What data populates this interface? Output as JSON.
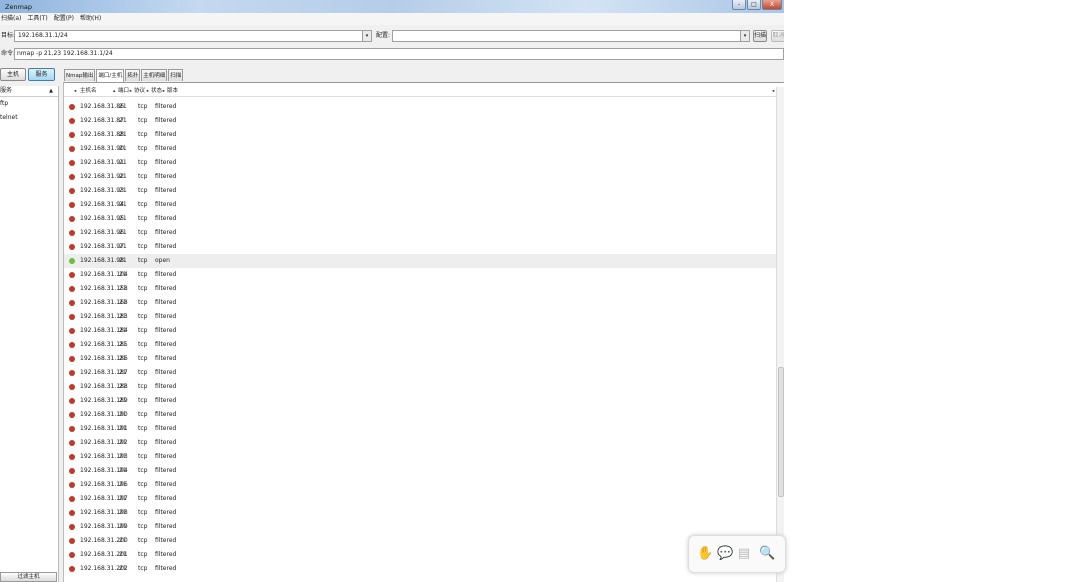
{
  "window": {
    "title": "Zenmap",
    "controls": [
      "-",
      "□",
      "X"
    ]
  },
  "menu": [
    "扫描(a)",
    "工具(T)",
    "配置(P)",
    "帮助(H)"
  ],
  "toolbar": {
    "target_label": "目标:",
    "target_value": "192.168.31.1/24",
    "profile_label": "配置:",
    "profile_value": "",
    "scan_button": "扫描",
    "cancel_button": "取消",
    "command_label": "命令:",
    "command_value": "nmap -p 21,23 192.168.31.1/24"
  },
  "sidebar": {
    "hosts_button": "主机",
    "services_button": "服务",
    "header": "服务",
    "items": [
      "ftp",
      "telnet"
    ],
    "filter_button": "过滤主机"
  },
  "tabs": [
    "Nmap输出",
    "端口/主机",
    "拓扑",
    "主机明细",
    "扫描"
  ],
  "columns": {
    "host": "主机名",
    "port": "端口",
    "protocol": "协议",
    "state": "状态",
    "version": "版本"
  },
  "rows": [
    {
      "host": "192.168.31.86",
      "port": "21",
      "protocol": "tcp",
      "state": "filtered"
    },
    {
      "host": "192.168.31.87",
      "port": "21",
      "protocol": "tcp",
      "state": "filtered"
    },
    {
      "host": "192.168.31.88",
      "port": "21",
      "protocol": "tcp",
      "state": "filtered"
    },
    {
      "host": "192.168.31.90",
      "port": "21",
      "protocol": "tcp",
      "state": "filtered"
    },
    {
      "host": "192.168.31.91",
      "port": "21",
      "protocol": "tcp",
      "state": "filtered"
    },
    {
      "host": "192.168.31.92",
      "port": "21",
      "protocol": "tcp",
      "state": "filtered"
    },
    {
      "host": "192.168.31.93",
      "port": "21",
      "protocol": "tcp",
      "state": "filtered"
    },
    {
      "host": "192.168.31.94",
      "port": "21",
      "protocol": "tcp",
      "state": "filtered"
    },
    {
      "host": "192.168.31.95",
      "port": "21",
      "protocol": "tcp",
      "state": "filtered"
    },
    {
      "host": "192.168.31.96",
      "port": "21",
      "protocol": "tcp",
      "state": "filtered"
    },
    {
      "host": "192.168.31.97",
      "port": "21",
      "protocol": "tcp",
      "state": "filtered"
    },
    {
      "host": "192.168.31.98",
      "port": "21",
      "protocol": "tcp",
      "state": "open"
    },
    {
      "host": "192.168.31.104",
      "port": "21",
      "protocol": "tcp",
      "state": "filtered"
    },
    {
      "host": "192.168.31.158",
      "port": "21",
      "protocol": "tcp",
      "state": "filtered"
    },
    {
      "host": "192.168.31.168",
      "port": "21",
      "protocol": "tcp",
      "state": "filtered"
    },
    {
      "host": "192.168.31.183",
      "port": "21",
      "protocol": "tcp",
      "state": "filtered"
    },
    {
      "host": "192.168.31.184",
      "port": "21",
      "protocol": "tcp",
      "state": "filtered"
    },
    {
      "host": "192.168.31.185",
      "port": "21",
      "protocol": "tcp",
      "state": "filtered"
    },
    {
      "host": "192.168.31.186",
      "port": "21",
      "protocol": "tcp",
      "state": "filtered"
    },
    {
      "host": "192.168.31.187",
      "port": "21",
      "protocol": "tcp",
      "state": "filtered"
    },
    {
      "host": "192.168.31.188",
      "port": "21",
      "protocol": "tcp",
      "state": "filtered"
    },
    {
      "host": "192.168.31.189",
      "port": "21",
      "protocol": "tcp",
      "state": "filtered"
    },
    {
      "host": "192.168.31.190",
      "port": "21",
      "protocol": "tcp",
      "state": "filtered"
    },
    {
      "host": "192.168.31.191",
      "port": "21",
      "protocol": "tcp",
      "state": "filtered"
    },
    {
      "host": "192.168.31.192",
      "port": "21",
      "protocol": "tcp",
      "state": "filtered"
    },
    {
      "host": "192.168.31.193",
      "port": "21",
      "protocol": "tcp",
      "state": "filtered"
    },
    {
      "host": "192.168.31.194",
      "port": "21",
      "protocol": "tcp",
      "state": "filtered"
    },
    {
      "host": "192.168.31.196",
      "port": "21",
      "protocol": "tcp",
      "state": "filtered"
    },
    {
      "host": "192.168.31.197",
      "port": "21",
      "protocol": "tcp",
      "state": "filtered"
    },
    {
      "host": "192.168.31.198",
      "port": "21",
      "protocol": "tcp",
      "state": "filtered"
    },
    {
      "host": "192.168.31.199",
      "port": "21",
      "protocol": "tcp",
      "state": "filtered"
    },
    {
      "host": "192.168.31.200",
      "port": "21",
      "protocol": "tcp",
      "state": "filtered"
    },
    {
      "host": "192.168.31.201",
      "port": "21",
      "protocol": "tcp",
      "state": "filtered"
    },
    {
      "host": "192.168.31.202",
      "port": "21",
      "protocol": "tcp",
      "state": "filtered"
    }
  ],
  "selected_row": 11,
  "colors": {
    "filtered_dot": "#c0392b",
    "open_dot": "#6cbf3a",
    "active_button": "#a6d6f4"
  },
  "floating_tools": [
    "hand-icon",
    "comment-icon",
    "document-icon",
    "zoom-icon"
  ]
}
